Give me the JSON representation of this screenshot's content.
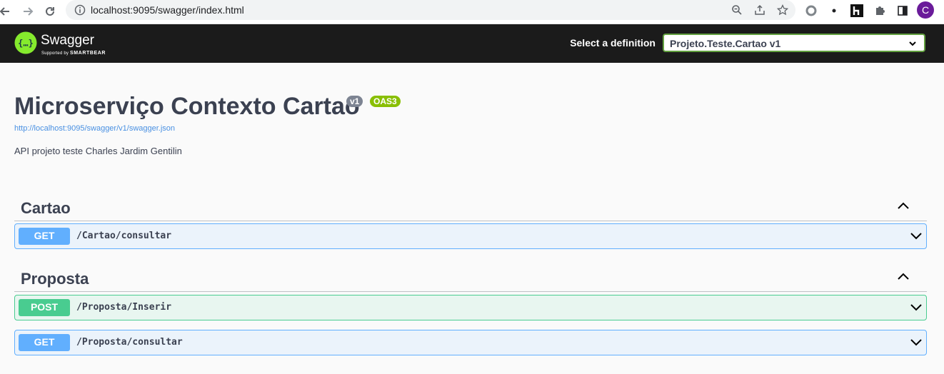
{
  "browser": {
    "url": "localhost:9095/swagger/index.html",
    "profile_initial": "C",
    "icons": [
      "back-arrow-icon",
      "forward-arrow-icon",
      "reload-icon",
      "info-icon",
      "zoom-icon",
      "share-icon",
      "star-icon",
      "circle-extension-icon",
      "dot-extension-icon",
      "h-extension-icon",
      "puzzle-icon",
      "sidepanel-icon",
      "profile-avatar"
    ]
  },
  "topbar": {
    "logo_text": "Swagger",
    "logo_sub_prefix": "Supported by",
    "logo_sub_brand": "SMARTBEAR",
    "select_label": "Select a definition",
    "selected_definition": "Projeto.Teste.Cartao v1"
  },
  "info": {
    "title": "Microserviço Contexto Cartao",
    "version_badge": "v1",
    "oas_badge": "OAS3",
    "spec_url": "http://localhost:9095/swagger/v1/swagger.json",
    "description": "API projeto teste Charles Jardim Gentilin"
  },
  "tags": [
    {
      "name": "Cartao",
      "operations": [
        {
          "method": "GET",
          "path": "/Cartao/consultar"
        }
      ]
    },
    {
      "name": "Proposta",
      "operations": [
        {
          "method": "POST",
          "path": "/Proposta/Inserir"
        },
        {
          "method": "GET",
          "path": "/Proposta/consultar"
        }
      ]
    }
  ],
  "colors": {
    "get": "#61affe",
    "post": "#49cc90",
    "topbar_bg": "#1b1b1b",
    "select_border": "#62a03f",
    "oas_badge": "#89bf04",
    "version_badge": "#7d8492",
    "link": "#4990e2"
  }
}
